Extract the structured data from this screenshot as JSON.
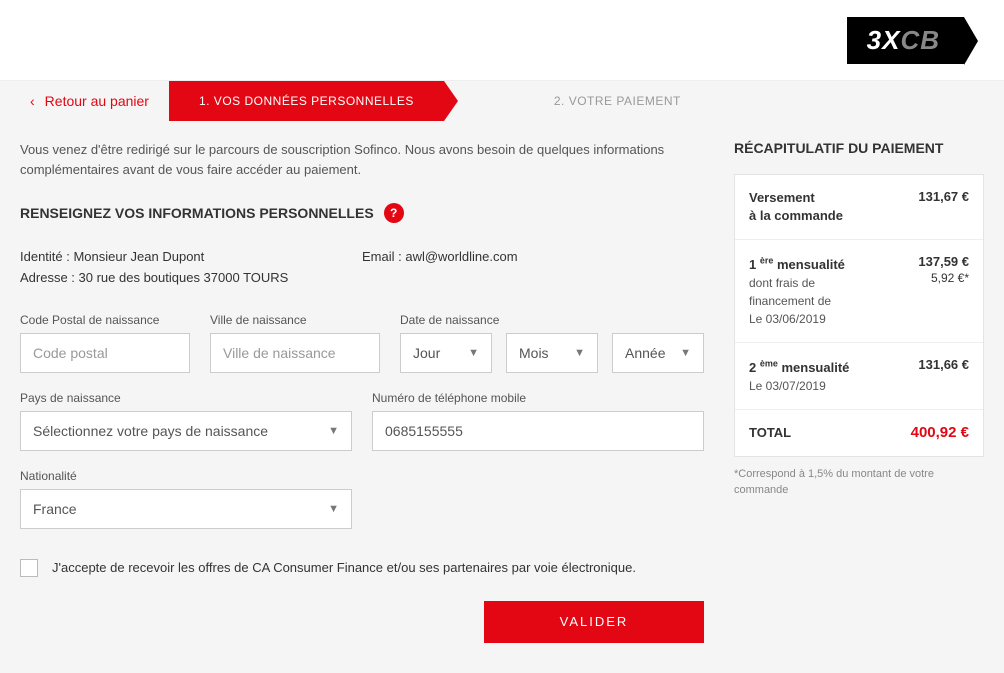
{
  "logo": {
    "x3": "3X",
    "cb": "CB"
  },
  "nav": {
    "back": "Retour au panier",
    "step1": "1. VOS DONNÉES PERSONNELLES",
    "step2": "2. VOTRE PAIEMENT"
  },
  "intro": "Vous venez d'être redirigé sur le parcours de souscription Sofinco. Nous avons besoin de quelques informations complémentaires avant de vous faire accéder au paiement.",
  "section_title": "RENSEIGNEZ VOS INFORMATIONS PERSONNELLES",
  "help_badge": "?",
  "identity": {
    "line1": "Identité : Monsieur Jean Dupont",
    "line2": "Adresse : 30 rue des boutiques 37000 TOURS",
    "email": "Email : awl@worldline.com"
  },
  "labels": {
    "cp_birth": "Code Postal de naissance",
    "city_birth": "Ville de naissance",
    "date_birth": "Date de naissance",
    "country_birth": "Pays de naissance",
    "phone": "Numéro de téléphone mobile",
    "nationality": "Nationalité"
  },
  "placeholders": {
    "cp": "Code postal",
    "city": "Ville de naissance"
  },
  "selects": {
    "day": "Jour",
    "month": "Mois",
    "year": "Année",
    "country": "Sélectionnez votre pays de naissance",
    "nationality": "France"
  },
  "values": {
    "phone": "0685155555"
  },
  "consent": "J'accepte de recevoir les offres de CA Consumer Finance et/ou ses partenaires par voie électronique.",
  "validate": "VALIDER",
  "summary": {
    "title": "RÉCAPITULATIF DU PAIEMENT",
    "row1": {
      "label": "Versement",
      "label2": "à la commande",
      "amount": "131,67 €"
    },
    "row2": {
      "label_html": "1 ère mensualité",
      "sub1": "dont frais de",
      "sub2": "financement de",
      "date": "Le 03/06/2019",
      "amount": "137,59 €",
      "sub_amount": "5,92 €*"
    },
    "row3": {
      "label_html": "2 ème mensualité",
      "date": "Le 03/07/2019",
      "amount": "131,66 €"
    },
    "total": {
      "label": "TOTAL",
      "amount": "400,92 €"
    },
    "note": "*Correspond à 1,5% du montant de votre commande"
  }
}
